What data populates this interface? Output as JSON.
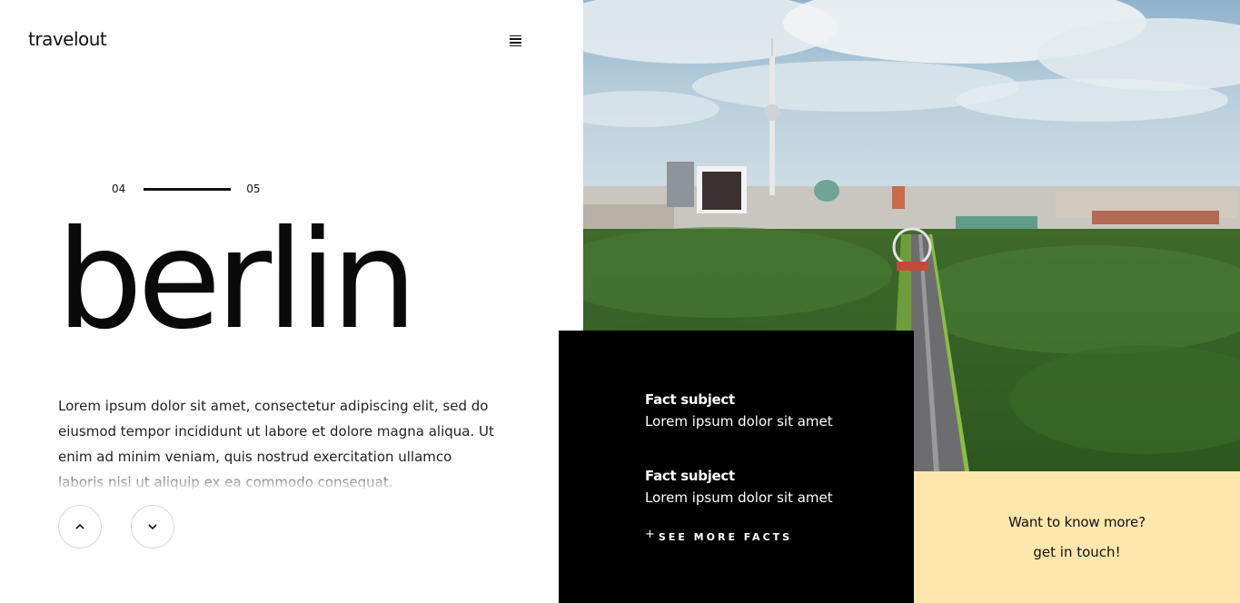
{
  "header": {
    "logo": "travelout",
    "menu_icon": "hamburger-menu-icon"
  },
  "pager": {
    "current": "04",
    "next": "05"
  },
  "hero": {
    "title": "berlin",
    "description": "Lorem ipsum dolor sit amet, consectetur adipiscing elit, sed do eiusmod tempor incididunt ut labore et dolore magna aliqua. Ut enim ad minim veniam, quis nostrud exercitation ullamco laboris nisi ut aliquip ex ea commodo consequat."
  },
  "nav": {
    "up_icon": "chevron-up-icon",
    "down_icon": "chevron-down-icon"
  },
  "facts": {
    "items": [
      {
        "title": "Fact subject",
        "text": "Lorem ipsum dolor sit amet"
      },
      {
        "title": "Fact subject",
        "text": "Lorem ipsum dolor sit amet"
      }
    ],
    "see_more_icon": "plus-icon",
    "see_more": "SEE MORE FACTS"
  },
  "contact": {
    "title": "Want to know more?",
    "link": "get in touch!"
  },
  "colors": {
    "panel_dark": "#000000",
    "panel_accent": "#fde7ad",
    "text": "#111111"
  }
}
